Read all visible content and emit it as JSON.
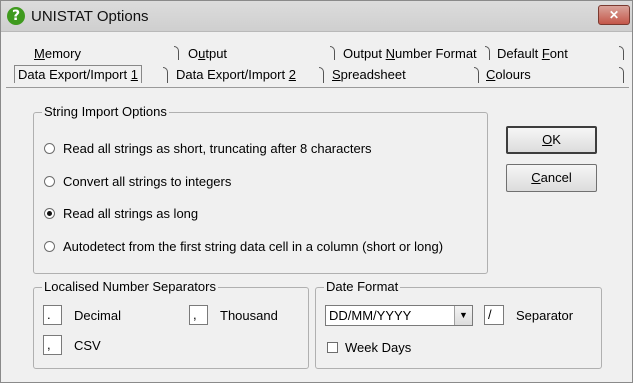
{
  "window": {
    "title": "UNISTAT Options",
    "close_label": "✕"
  },
  "tabs": {
    "row1": [
      {
        "label": "Memory",
        "accel": "M",
        "rest": "emory"
      },
      {
        "label": "Output",
        "pre": "O",
        "accel": "u",
        "rest": "tput"
      },
      {
        "label": "Output Number Format",
        "pre": "Output ",
        "accel": "N",
        "rest": "umber Format"
      },
      {
        "label": "Default Font",
        "pre": "Default ",
        "accel": "F",
        "rest": "ont"
      }
    ],
    "row2": [
      {
        "label": "Data Export/Import 1",
        "pre": "Data Export/Import ",
        "accel": "1",
        "rest": "",
        "active": true
      },
      {
        "label": "Data Export/Import 2",
        "pre": "Data Export/Import ",
        "accel": "2",
        "rest": ""
      },
      {
        "label": "Spreadsheet",
        "pre": "",
        "accel": "S",
        "rest": "preadsheet"
      },
      {
        "label": "Colours",
        "pre": "",
        "accel": "C",
        "rest": "olours"
      }
    ]
  },
  "string_import": {
    "legend": "String Import Options",
    "options": [
      {
        "label": "Read all strings as short, truncating after 8 characters",
        "selected": false
      },
      {
        "label": "Convert all strings to integers",
        "selected": false
      },
      {
        "label": "Read all strings as long",
        "selected": true
      },
      {
        "label": "Autodetect from the first string data cell in a column (short or long)",
        "selected": false
      }
    ]
  },
  "buttons": {
    "ok_accel": "O",
    "ok_rest": "K",
    "cancel_accel": "C",
    "cancel_rest": "ancel"
  },
  "separators": {
    "legend": "Localised Number Separators",
    "decimal_value": ".",
    "decimal_label": "Decimal",
    "thousand_value": ",",
    "thousand_label": "Thousand",
    "csv_value": ",",
    "csv_label": "CSV"
  },
  "date_format": {
    "legend": "Date Format",
    "selected_format": "DD/MM/YYYY",
    "separator_value": "/",
    "separator_label": "Separator",
    "week_days_label": "Week Days",
    "week_days_checked": false
  }
}
